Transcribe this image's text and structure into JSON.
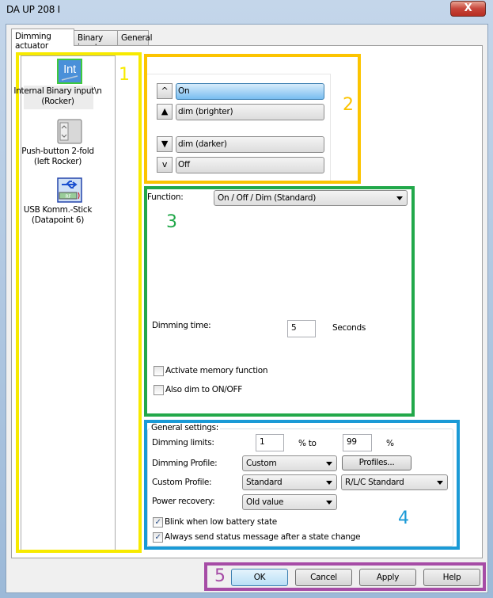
{
  "window": {
    "title": "DA UP 208 I",
    "close": "X"
  },
  "tabs": [
    {
      "label": "Dimming actuator"
    },
    {
      "label": "Binary input"
    },
    {
      "label": "General"
    }
  ],
  "devices": [
    {
      "icon": "int-binary-input-icon",
      "line1": "Internal Binary input\\n",
      "line2": "(Rocker)",
      "selected": true
    },
    {
      "icon": "push-button-icon",
      "line1": "Push-button 2-fold",
      "line2": "(left Rocker)"
    },
    {
      "icon": "usb-stick-icon",
      "line1": "USB Komm.-Stick",
      "line2": "(Datapoint 6)"
    }
  ],
  "rocker": [
    {
      "arrow": "^",
      "label": "On",
      "active": true
    },
    {
      "arrow": "▲",
      "label": "dim (brighter)"
    },
    {
      "arrow": "▼",
      "label": "dim (darker)"
    },
    {
      "arrow": "v",
      "label": "Off"
    }
  ],
  "function": {
    "label": "Function:",
    "value": "On / Off / Dim (Standard)"
  },
  "dimming_time": {
    "label": "Dimming time:",
    "value": "5",
    "unit": "Seconds"
  },
  "options": [
    {
      "label": "Activate memory function",
      "checked": false
    },
    {
      "label": "Also dim to ON/OFF",
      "checked": false
    }
  ],
  "general": {
    "title": "General settings:",
    "limits_label": "Dimming limits:",
    "min": "1",
    "to": "% to",
    "max": "99",
    "pct": "%",
    "profile_label": "Dimming Profile:",
    "profile": "Custom",
    "profiles_button": "Profiles...",
    "custom_label": "Custom Profile:",
    "custom": "Standard",
    "load": "R/L/C Standard",
    "power_label": "Power recovery:",
    "power": "Old value",
    "blink": {
      "label": "Blink when low battery state",
      "checked": true
    },
    "status": {
      "label": "Always send status message after a state change",
      "checked": true
    }
  },
  "buttons": {
    "ok": "OK",
    "cancel": "Cancel",
    "apply": "Apply",
    "help": "Help"
  },
  "annotations": {
    "n1": "1",
    "n2": "2",
    "n3": "3",
    "n4": "4",
    "n5": "5"
  },
  "colors": {
    "yellow": "#f7ea00",
    "orange": "#fcc400",
    "green": "#22a84a",
    "blue": "#1a9ad6",
    "purple": "#a64ca6"
  }
}
